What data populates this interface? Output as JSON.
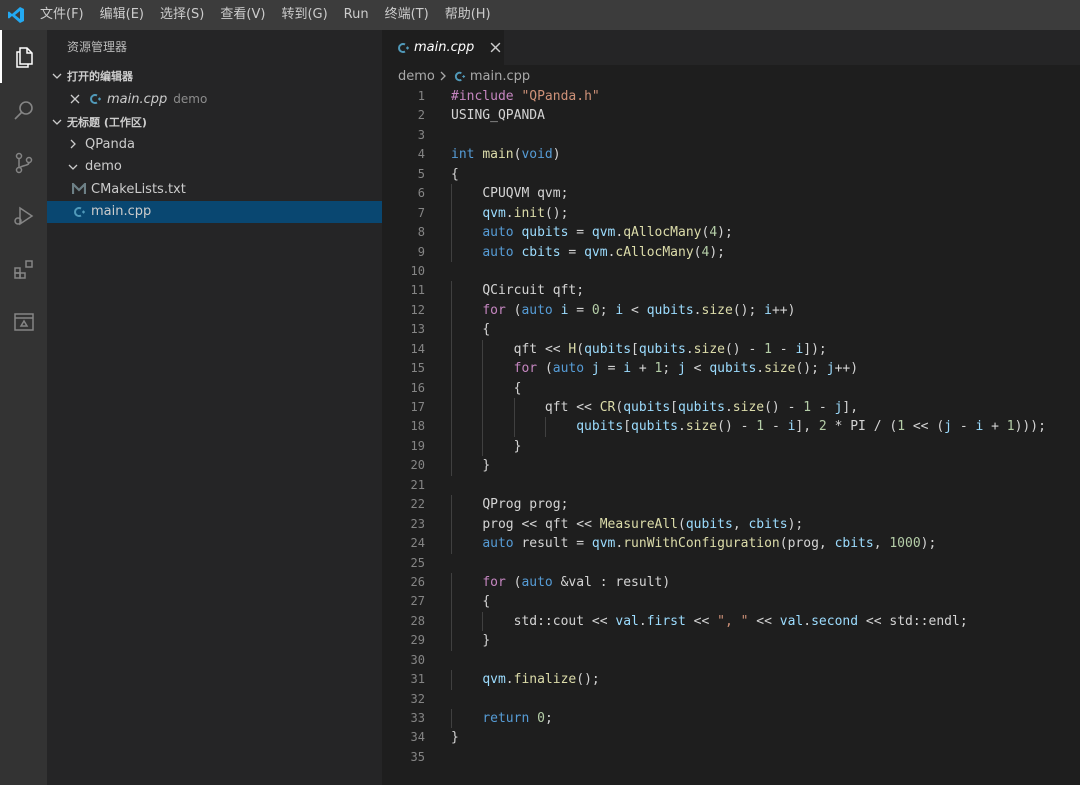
{
  "menu": [
    "文件(F)",
    "编辑(E)",
    "选择(S)",
    "查看(V)",
    "转到(G)",
    "Run",
    "终端(T)",
    "帮助(H)"
  ],
  "sidebar": {
    "title": "资源管理器",
    "open_editors_header": "打开的编辑器",
    "open_editor": {
      "name": "main.cpp",
      "folder": "demo"
    },
    "workspace_header": "无标题 (工作区)",
    "tree": [
      {
        "label": "QPanda",
        "kind": "folder-collapsed",
        "depth": 1
      },
      {
        "label": "demo",
        "kind": "folder-expanded",
        "depth": 1
      },
      {
        "label": "CMakeLists.txt",
        "kind": "cmake",
        "depth": 2
      },
      {
        "label": "main.cpp",
        "kind": "cpp",
        "depth": 2,
        "selected": true
      }
    ]
  },
  "editor": {
    "tab": {
      "label": "main.cpp"
    },
    "breadcrumb": {
      "folder": "demo",
      "file": "main.cpp"
    },
    "lines": [
      "#include \"QPanda.h\"",
      "USING_QPANDA",
      "",
      "int main(void)",
      "{",
      "    CPUQVM qvm;",
      "    qvm.init();",
      "    auto qubits = qvm.qAllocMany(4);",
      "    auto cbits = qvm.cAllocMany(4);",
      "",
      "    QCircuit qft;",
      "    for (auto i = 0; i < qubits.size(); i++)",
      "    {",
      "        qft << H(qubits[qubits.size() - 1 - i]);",
      "        for (auto j = i + 1; j < qubits.size(); j++)",
      "        {",
      "            qft << CR(qubits[qubits.size() - 1 - j],",
      "                qubits[qubits.size() - 1 - i], 2 * PI / (1 << (j - i + 1)));",
      "        }",
      "    }",
      "",
      "    QProg prog;",
      "    prog << qft << MeasureAll(qubits, cbits);",
      "    auto result = qvm.runWithConfiguration(prog, cbits, 1000);",
      "",
      "    for (auto &val : result)",
      "    {",
      "        std::cout << val.first << \", \" << val.second << std::endl;",
      "    }",
      "",
      "    qvm.finalize();",
      "",
      "    return 0;",
      "}",
      ""
    ]
  },
  "colors": {
    "accent_blue": "#007acc",
    "selection": "#094771",
    "cpp_icon": "#519aba",
    "cmake_icon": "#6d8086"
  }
}
